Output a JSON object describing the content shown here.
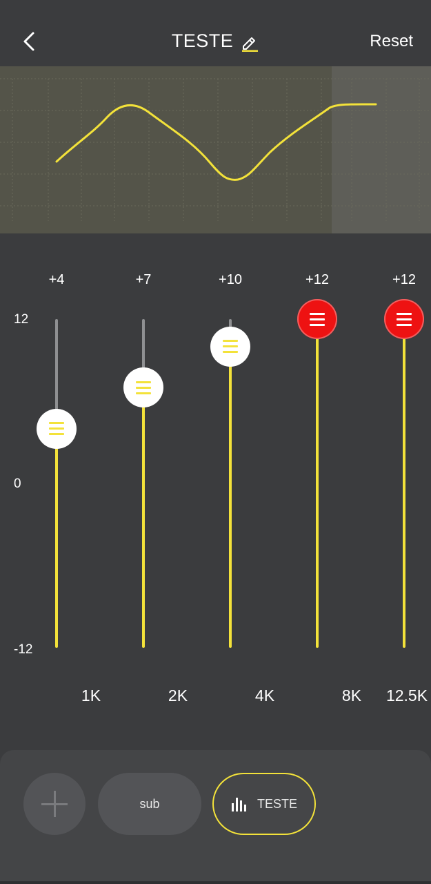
{
  "header": {
    "title": "TESTE",
    "reset_label": "Reset"
  },
  "equalizer": {
    "scale": {
      "max": "12",
      "mid": "0",
      "min": "-12"
    },
    "bands": [
      {
        "freq": "1K",
        "gain_label": "+4",
        "gain": 4
      },
      {
        "freq": "2K",
        "gain_label": "+7",
        "gain": 7
      },
      {
        "freq": "4K",
        "gain_label": "+10",
        "gain": 10
      },
      {
        "freq": "8K",
        "gain_label": "+12",
        "gain": 12
      },
      {
        "freq": "12.5K",
        "gain_label": "+12",
        "gain": 12
      }
    ]
  },
  "presets": {
    "items": [
      {
        "label": "sub",
        "active": false
      },
      {
        "label": "TESTE",
        "active": true,
        "icon": "equalizer-bars-icon"
      }
    ]
  },
  "colors": {
    "accent": "#f3e23a",
    "knob_max": "#ee1212",
    "background": "#3b3c3e"
  }
}
